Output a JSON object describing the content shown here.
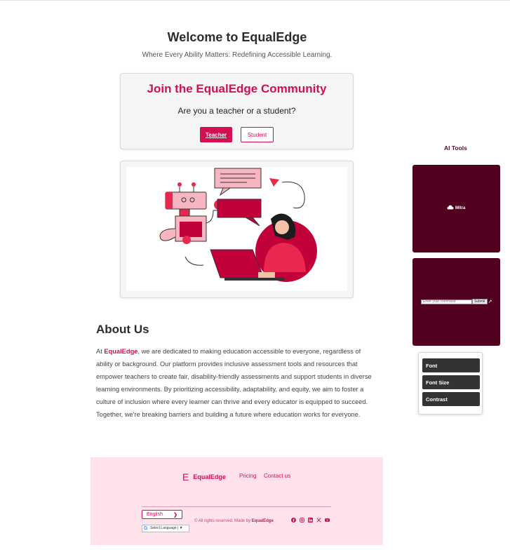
{
  "header": {
    "title": "Welcome to EqualEdge",
    "subtitle": "Where Every Ability Matters: Redefining Accessible Learning."
  },
  "join": {
    "title": "Join the EqualEdge Community",
    "question": "Are you a teacher or a student?",
    "teacher_label": "Teacher",
    "student_label": "Student"
  },
  "about": {
    "heading": "About Us",
    "intro": "At ",
    "brand": "EqualEdge",
    "body": ", we are dedicated to making education accessible to everyone, regardless of ability or background. Our platform provides inclusive assessment tools and resources that empower teachers to create fair, disability-friendly assessments and support students in diverse learning environments. By prioritizing accessibility, adaptability, and equity, we aim to foster a culture of inclusion where every learner can thrive and every educator is equipped to succeed. Together, we're breaking barriers and building a future where education works for everyone."
  },
  "footer": {
    "logo_letter": "E",
    "logo_text": "EqualEdge",
    "links": [
      "Pricing",
      "Contact us"
    ],
    "language": "English",
    "google_translate": "Select Language",
    "copyright_prefix": "© All rights reserved. Made by ",
    "copyright_brand": "EqualEdge",
    "socials": [
      "facebook-icon",
      "instagram-icon",
      "linkedin-icon",
      "x-icon",
      "youtube-icon"
    ]
  },
  "ai_tools": {
    "label": "AI Tools",
    "assistant_name": "Mitra",
    "command_placeholder": "Enter your command",
    "submit_label": "Submit"
  },
  "accessibility": {
    "buttons": [
      "Font",
      "Font Size",
      "Contrast"
    ]
  },
  "colors": {
    "brand": "#d2104f",
    "ai_panel": "#51001f",
    "footer_bg": "#ffe2ea"
  }
}
